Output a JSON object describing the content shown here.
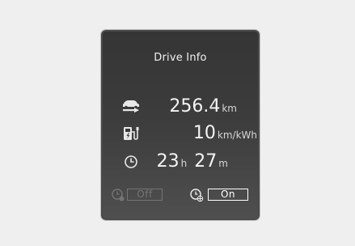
{
  "panel": {
    "title": "Drive Info",
    "distance": {
      "value": "256.4",
      "unit": "km",
      "icon": "car-range-icon"
    },
    "efficiency": {
      "value": "10",
      "unit": "km/kWh",
      "icon": "charging-station-icon"
    },
    "drive_time": {
      "hours": "23",
      "hours_unit": "h",
      "minutes": "27",
      "minutes_unit": "m",
      "icon": "clock-icon"
    },
    "toggles": {
      "off_label": "Off",
      "off_icon": "timer-reset-icon",
      "off_state": "dimmed",
      "on_label": "On",
      "on_icon": "timer-fan-icon",
      "on_state": "selected"
    }
  },
  "colors": {
    "background": "#efefef",
    "panel": "#3a3a3a",
    "text": "#f4f4f4"
  }
}
